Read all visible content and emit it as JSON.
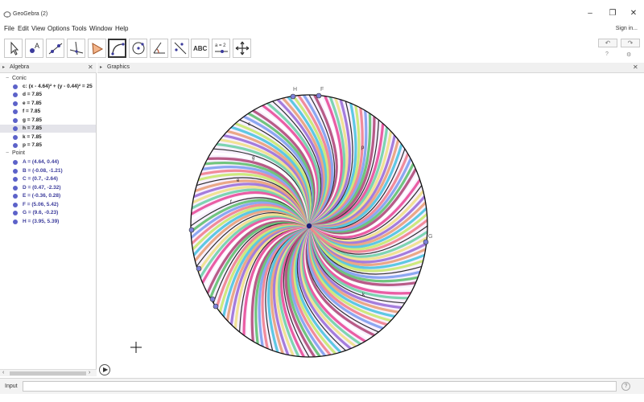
{
  "window": {
    "title": "GeoGebra (2)",
    "minimize_glyph": "–",
    "maximize_glyph": "❐",
    "close_glyph": "✕"
  },
  "menu": {
    "items": [
      "File",
      "Edit",
      "View",
      "Options",
      "Tools",
      "Window",
      "Help"
    ],
    "sign_in": "Sign in..."
  },
  "toolbar": {
    "tools": [
      {
        "icon": "move-arrow-icon"
      },
      {
        "icon": "point-icon",
        "label": "A"
      },
      {
        "icon": "line-icon"
      },
      {
        "icon": "perpendicular-line-icon"
      },
      {
        "icon": "polygon-icon"
      },
      {
        "icon": "arc-icon",
        "active": true
      },
      {
        "icon": "circle-center-point-icon"
      },
      {
        "icon": "angle-icon"
      },
      {
        "icon": "reflect-icon"
      },
      {
        "icon": "text-icon",
        "label": "ABC"
      },
      {
        "icon": "slider-icon",
        "label": "a = 2"
      },
      {
        "icon": "move-graphics-view-icon"
      }
    ],
    "undo_glyph": "↶",
    "redo_glyph": "↷",
    "help_glyph": "?",
    "settings_glyph": "⚙"
  },
  "algebra": {
    "header": "Algebra",
    "categories": [
      {
        "name": "Conic",
        "items": [
          {
            "text": "c: (x - 4.64)² + (y - 0.44)² = 25",
            "highlight": false
          },
          {
            "text": "d = 7.85",
            "highlight": false
          },
          {
            "text": "e = 7.85",
            "highlight": false
          },
          {
            "text": "f = 7.85",
            "highlight": false
          },
          {
            "text": "g = 7.85",
            "highlight": false
          },
          {
            "text": "h = 7.85",
            "highlight": true
          },
          {
            "text": "k = 7.85",
            "highlight": false
          },
          {
            "text": "p = 7.85",
            "highlight": false
          }
        ]
      },
      {
        "name": "Point",
        "items": [
          {
            "text": "A = (4.64, 0.44)",
            "highlight": false
          },
          {
            "text": "B = (-0.08, -1.21)",
            "highlight": false
          },
          {
            "text": "C = (0.7, -2.64)",
            "highlight": false
          },
          {
            "text": "D = (0.47, -2.32)",
            "highlight": false
          },
          {
            "text": "E = (-0.36, 0.28)",
            "highlight": false
          },
          {
            "text": "F = (5.06, 5.42)",
            "highlight": false
          },
          {
            "text": "G = (9.6, -0.23)",
            "highlight": false
          },
          {
            "text": "H = (3.95, 5.39)",
            "highlight": false
          }
        ]
      }
    ]
  },
  "graphics": {
    "header": "Graphics",
    "point_labels": [
      "H",
      "F",
      "G"
    ],
    "curve_labels": [
      "c",
      "g",
      "e",
      "f",
      "p",
      "k"
    ],
    "colors": [
      "#e84d9a",
      "#6fd0a8",
      "#f0e08a",
      "#9a6fd8",
      "#e8a07a",
      "#4cc3e0",
      "#c8e870",
      "#f07f8f",
      "#7f9ff0",
      "#60c070",
      "#b04a7a",
      "#ffffff"
    ]
  },
  "input": {
    "label": "Input",
    "value": "",
    "help_glyph": "?"
  }
}
